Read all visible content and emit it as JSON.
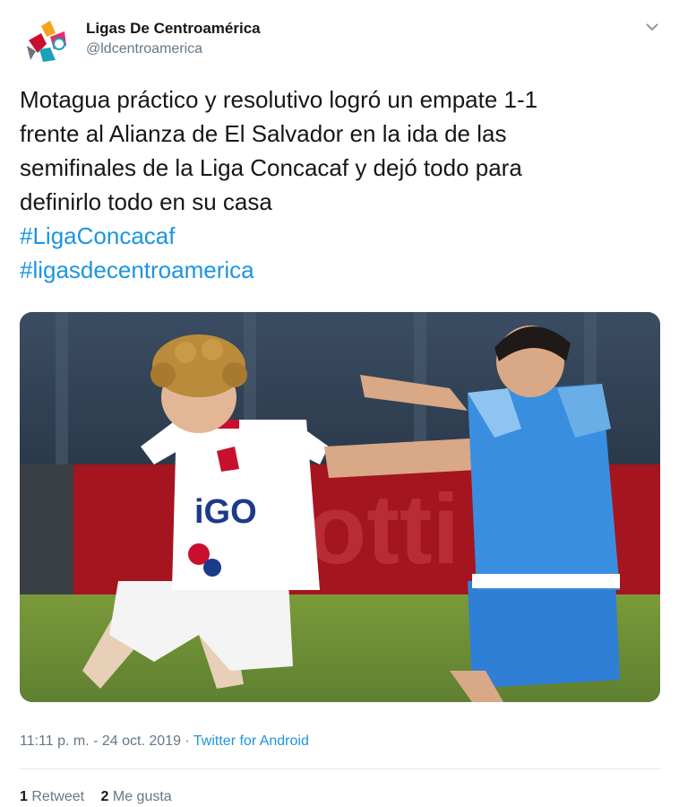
{
  "account": {
    "name": "Ligas De Centroamérica",
    "handle": "@ldcentroamerica"
  },
  "tweet": {
    "lines": [
      "Motagua práctico y resolutivo logró un empate 1-1",
      "frente al Alianza de El Salvador en la ida de las",
      "semifinales de la Liga Concacaf y dejó todo para",
      "definirlo todo en su casa"
    ],
    "hashtags": [
      "#LigaConcacaf",
      "#ligasdecentroamerica"
    ]
  },
  "meta": {
    "time": "11:11 p. m.",
    "separator1": " - ",
    "date": "24 oct. 2019",
    "separator2": " · ",
    "source": "Twitter for Android"
  },
  "stats": {
    "retweets_count": "1",
    "retweets_label": "Retweet",
    "likes_count": "2",
    "likes_label": "Me gusta"
  },
  "icons": {
    "menu": "chevron-down-icon",
    "avatar": "logo-avatar"
  },
  "colors": {
    "link": "#1b95e0",
    "muted": "#657786",
    "text": "#14171a"
  }
}
